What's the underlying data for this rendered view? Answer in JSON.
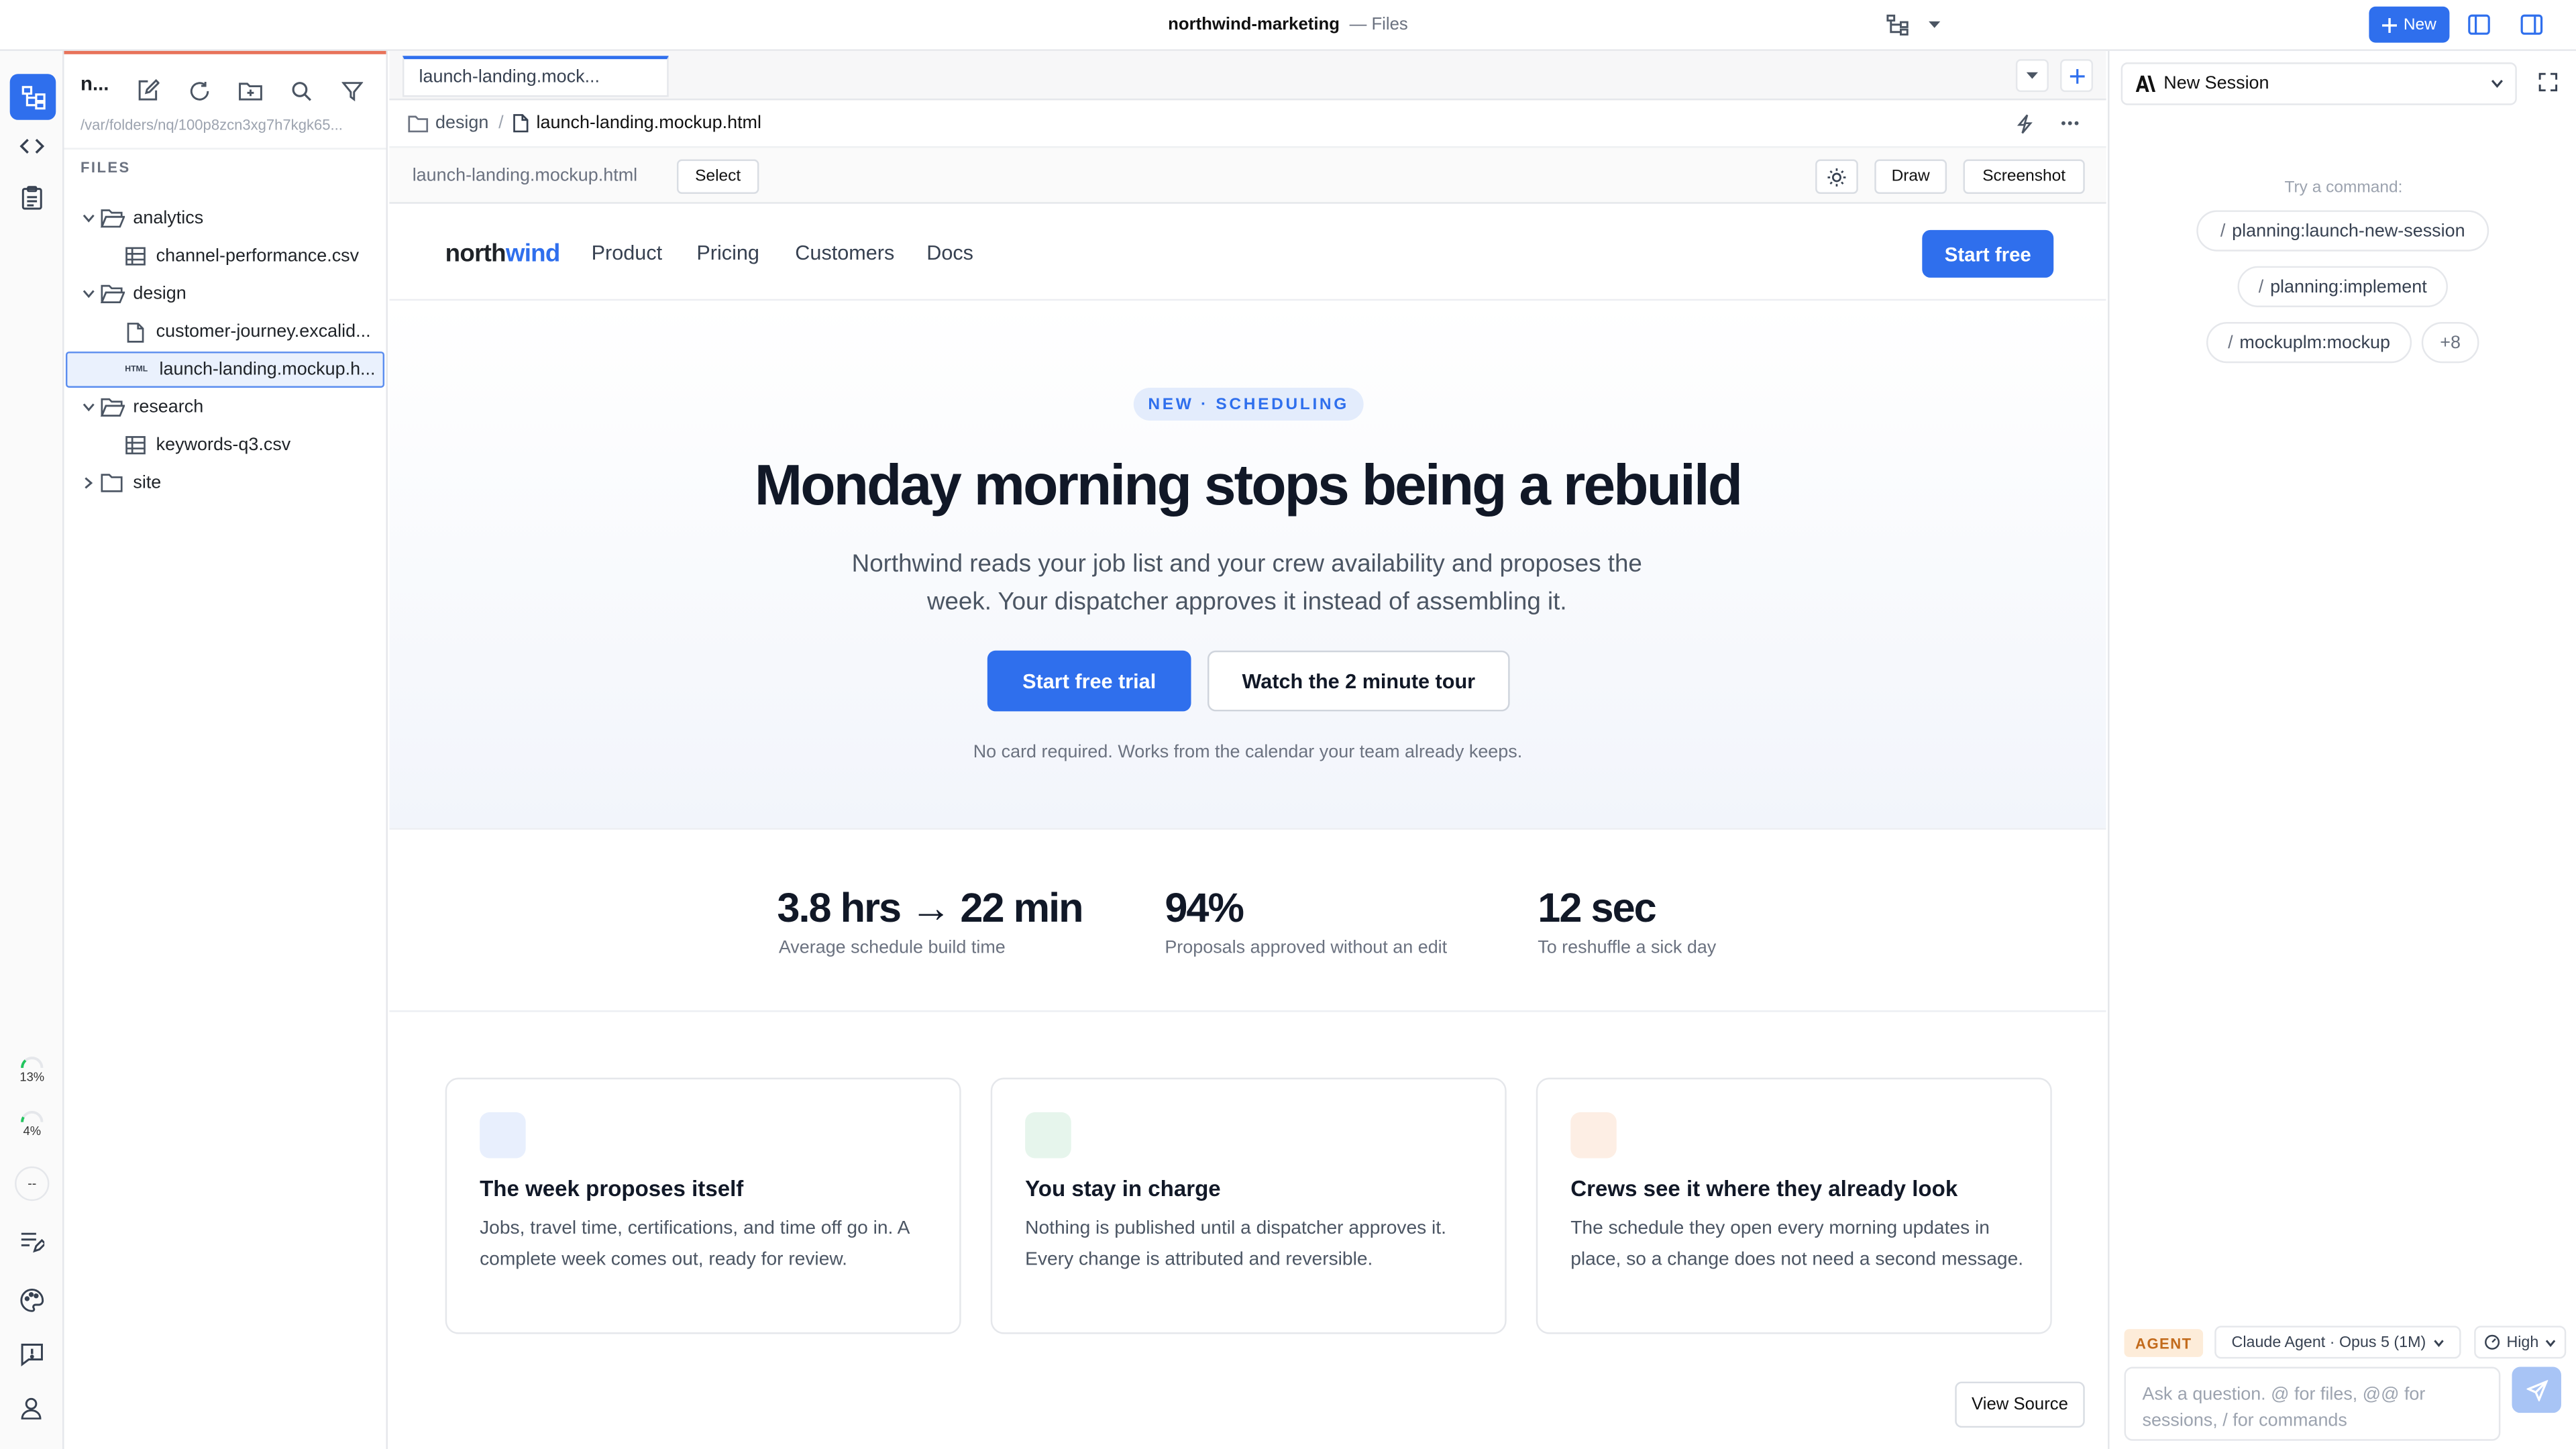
{
  "window": {
    "title": "northwind-marketing",
    "subtitle": "Files",
    "new_label": "New"
  },
  "activity": {
    "gauge_1": "13%",
    "gauge_2": "4%",
    "gauge_3": "--"
  },
  "explorer": {
    "title": "n...",
    "path": "/var/folders/nq/100p8zcn3xg7h7kgk65...",
    "section": "FILES",
    "tree": [
      {
        "label": "analytics",
        "kind": "folder",
        "expanded": true
      },
      {
        "label": "channel-performance.csv",
        "kind": "table"
      },
      {
        "label": "design",
        "kind": "folder",
        "expanded": true
      },
      {
        "label": "customer-journey.excalid...",
        "kind": "file"
      },
      {
        "label": "launch-landing.mockup.h...",
        "kind": "html",
        "selected": true,
        "badge": "HTML"
      },
      {
        "label": "research",
        "kind": "folder",
        "expanded": true
      },
      {
        "label": "keywords-q3.csv",
        "kind": "table"
      },
      {
        "label": "site",
        "kind": "folder",
        "expanded": false
      }
    ]
  },
  "editor": {
    "tab": "launch-landing.mock...",
    "crumb_folder": "design",
    "crumb_file": "launch-landing.mockup.html",
    "toolbar_file": "launch-landing.mockup.html",
    "select_label": "Select",
    "draw_label": "Draw",
    "screenshot_label": "Screenshot"
  },
  "preview": {
    "logo_a": "north",
    "logo_b": "wind",
    "nav": [
      "Product",
      "Pricing",
      "Customers",
      "Docs"
    ],
    "nav_cta": "Start free",
    "badge": "NEW · SCHEDULING",
    "headline": "Monday morning stops being a rebuild",
    "lead": "Northwind reads your job list and your crew availability and proposes the week. Your dispatcher approves it instead of assembling it.",
    "cta_primary": "Start free trial",
    "cta_secondary": "Watch the 2 minute tour",
    "fine_print": "No card required. Works from the calendar your team already keeps.",
    "stats": [
      {
        "value": "3.8 hrs → 22 min",
        "label": "Average schedule build time"
      },
      {
        "value": "94%",
        "label": "Proposals approved without an edit"
      },
      {
        "value": "12 sec",
        "label": "To reshuffle a sick day"
      }
    ],
    "cards": [
      {
        "title": "The week proposes itself",
        "body": "Jobs, travel time, certifications, and time off go in. A complete week comes out, ready for review.",
        "color": "#e8effd"
      },
      {
        "title": "You stay in charge",
        "body": "Nothing is published until a dispatcher approves it. Every change is attributed and reversible.",
        "color": "#e6f5ec"
      },
      {
        "title": "Crews see it where they already look",
        "body": "The schedule they open every morning updates in place, so a change does not need a second message.",
        "color": "#fdeee4"
      }
    ],
    "view_source": "View Source"
  },
  "panel": {
    "session": "New Session",
    "try_label": "Try a command:",
    "commands": [
      "planning:launch-new-session",
      "planning:implement",
      "mockuplm:mockup"
    ],
    "more": "+8",
    "agent_tag": "AGENT",
    "model": "Claude Agent · Opus 5 (1M)",
    "effort": "High",
    "ask_placeholder": "Ask a question. @ for files, @@ for sessions, / for commands"
  },
  "colors": {
    "accent": "#2f6fed",
    "explorer_accent": "#e8735a"
  }
}
